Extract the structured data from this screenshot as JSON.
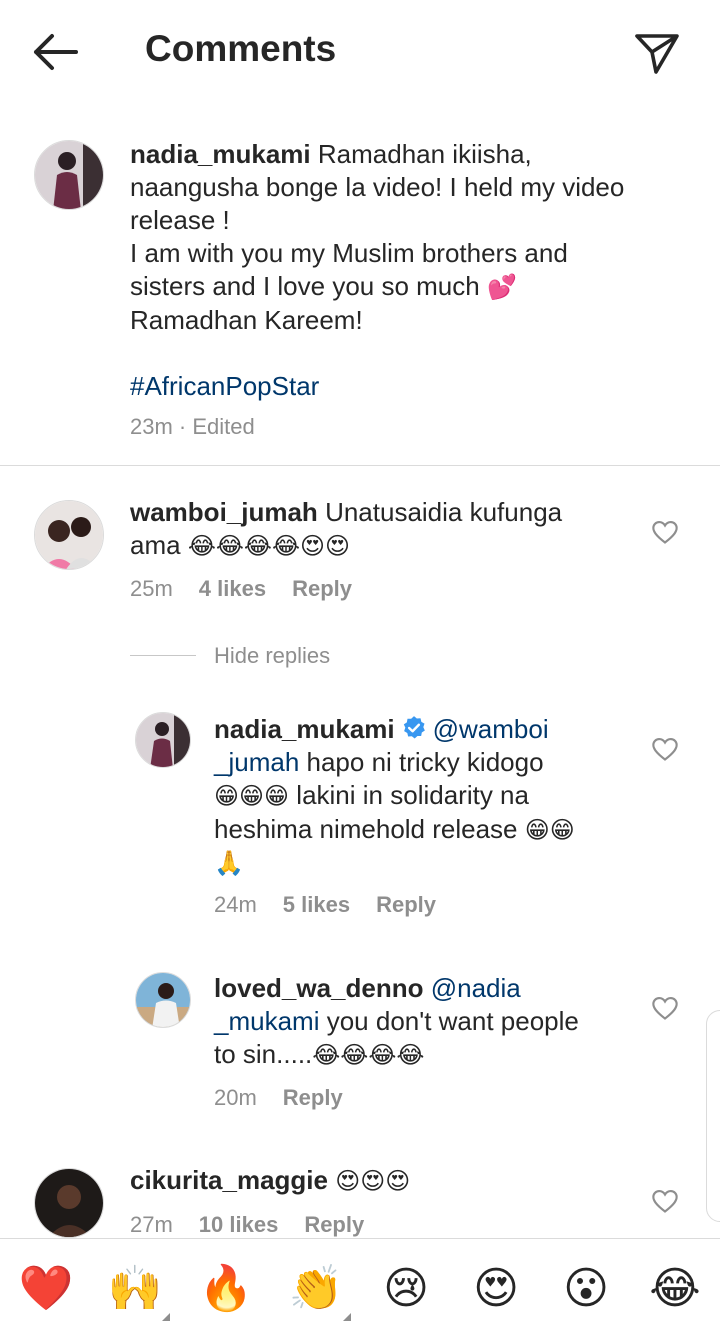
{
  "header": {
    "title": "Comments"
  },
  "caption": {
    "username": "nadia_mukami",
    "line1": "Ramadhan ikiisha,",
    "line2": "naangusha bonge la video! I held my video",
    "line3": "release !",
    "line4": "I am with you my Muslim brothers and",
    "line5": "sisters and I love you so much",
    "line5_emoji": "💕",
    "line6": "Ramadhan Kareem!",
    "hashtag": "#AfricanPopStar",
    "meta": "23m · Edited"
  },
  "comments": [
    {
      "username": "wamboi_jumah",
      "line1": "Unatusaidia kufunga",
      "line2": "ama",
      "line2_emoji": "😂😂😂😂😍😍",
      "time": "25m",
      "likes": "4 likes",
      "reply": "Reply"
    }
  ],
  "replies_toggle": "Hide replies",
  "replies": [
    {
      "username": "nadia_mukami",
      "mention_a": "@wamboi",
      "mention_b": "_jumah",
      "line2_rest": "hapo ni tricky kidogo",
      "line3_emoji": "😁😁😁",
      "line3_text": "lakini in solidarity na",
      "line4_text": "heshima nimehold release",
      "line4_emoji": "😁😁",
      "line5_emoji": "🙏",
      "time": "24m",
      "likes": "5 likes",
      "reply": "Reply"
    },
    {
      "username": "loved_wa_denno",
      "mention_a": "@nadia",
      "mention_b": "_mukami",
      "line2_rest": "you don't want people",
      "line3_text": "to sin.....",
      "line3_emoji": "😂😂😂😂",
      "time": "20m",
      "reply": "Reply"
    }
  ],
  "last_comment": {
    "username": "cikurita_maggie",
    "emoji": "😍😍😍",
    "time": "27m",
    "likes": "10 likes",
    "reply": "Reply"
  },
  "emoji_bar": [
    "❤️",
    "🙌",
    "🔥",
    "👏",
    "😢",
    "😍",
    "😮",
    "😂"
  ],
  "colors": {
    "link": "#00376b",
    "meta": "#8e8e8e",
    "verified": "#3897f0",
    "heart": "#ed4956"
  },
  "icons": [
    "back-arrow-icon",
    "send-icon",
    "heart-outline-icon",
    "verified-badge-icon"
  ]
}
